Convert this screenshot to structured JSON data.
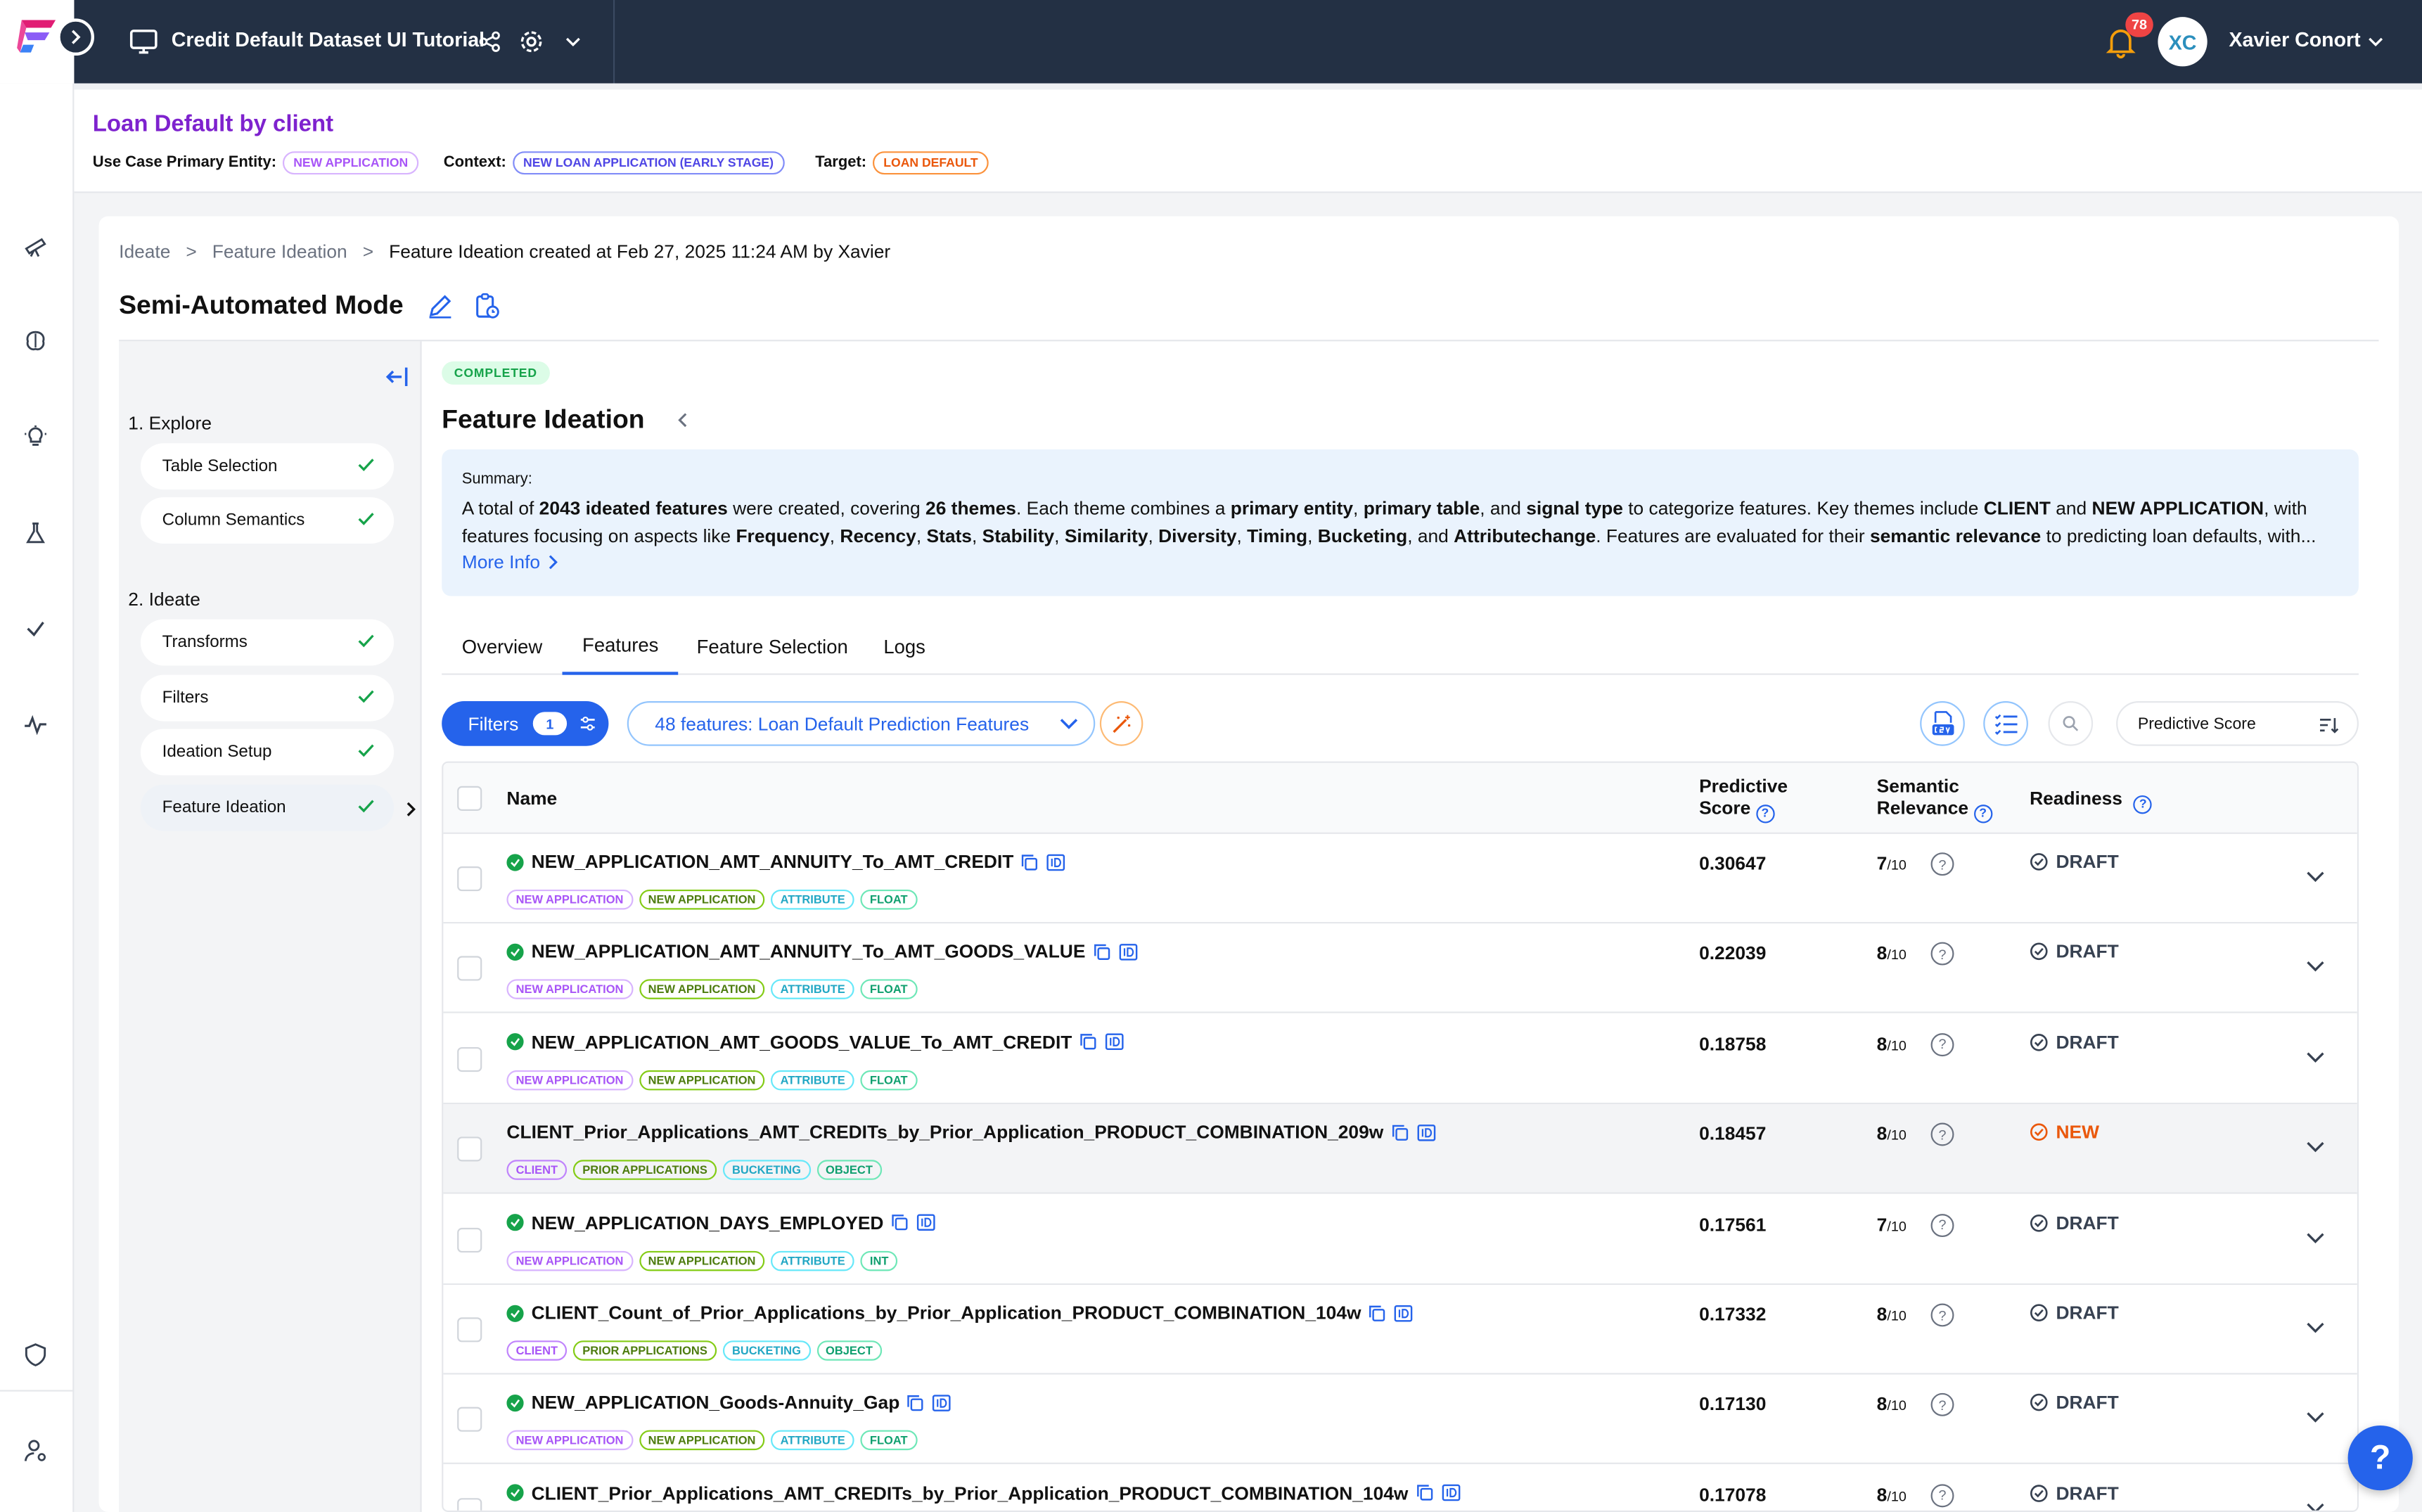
{
  "topbar": {
    "title": "Credit Default Dataset UI Tutorial",
    "notifications": "78",
    "avatar_initials": "XC",
    "user_name": "Xavier Conort"
  },
  "use_case": {
    "title": "Loan Default by client",
    "primary_entity_label": "Use Case Primary Entity:",
    "primary_entity": "NEW APPLICATION",
    "context_label": "Context:",
    "context": "NEW LOAN APPLICATION (EARLY STAGE)",
    "target_label": "Target:",
    "target": "LOAN DEFAULT"
  },
  "breadcrumb": [
    "Ideate",
    "Feature Ideation",
    "Feature Ideation created at Feb 27, 2025 11:24 AM by Xavier"
  ],
  "mode_title": "Semi-Automated Mode",
  "steps": {
    "explore_label": "1. Explore",
    "explore": [
      "Table Selection",
      "Column Semantics"
    ],
    "ideate_label": "2. Ideate",
    "ideate": [
      "Transforms",
      "Filters",
      "Ideation Setup",
      "Feature Ideation"
    ]
  },
  "status": "COMPLETED",
  "section_title": "Feature Ideation",
  "summary": {
    "heading": "Summary:",
    "line1": [
      {
        "t": "A total of "
      },
      {
        "b": "2043 ideated features"
      },
      {
        "t": " were created, covering "
      },
      {
        "b": "26 themes"
      },
      {
        "t": ". Each theme combines a "
      },
      {
        "b": "primary entity"
      },
      {
        "t": ", "
      },
      {
        "b": "primary table"
      },
      {
        "t": ", and "
      },
      {
        "b": "signal type"
      },
      {
        "t": " to categorize features. Key themes include "
      },
      {
        "b": "CLIENT"
      },
      {
        "t": " and "
      },
      {
        "b": "NEW APPLICATION"
      },
      {
        "t": ", with"
      }
    ],
    "line2": [
      {
        "t": "features focusing on aspects like "
      },
      {
        "b": "Frequency"
      },
      {
        "t": ", "
      },
      {
        "b": "Recency"
      },
      {
        "t": ", "
      },
      {
        "b": "Stats"
      },
      {
        "t": ", "
      },
      {
        "b": "Stability"
      },
      {
        "t": ", "
      },
      {
        "b": "Similarity"
      },
      {
        "t": ", "
      },
      {
        "b": "Diversity"
      },
      {
        "t": ", "
      },
      {
        "b": "Timing"
      },
      {
        "t": ", "
      },
      {
        "b": "Bucketing"
      },
      {
        "t": ", and "
      },
      {
        "b": "Attributechange"
      },
      {
        "t": ". Features are evaluated for their "
      },
      {
        "b": "semantic relevance"
      },
      {
        "t": " to predicting loan defaults, with..."
      }
    ],
    "more": "More Info"
  },
  "tabs": [
    "Overview",
    "Features",
    "Feature Selection",
    "Logs"
  ],
  "toolbar": {
    "filters_label": "Filters",
    "filters_count": "1",
    "feature_list": "48 features: Loan Default Prediction Features",
    "sort_label": "Predictive Score"
  },
  "table": {
    "col_name": "Name",
    "col_score_1": "Predictive",
    "col_score_2": "Score",
    "col_rel_1": "Semantic",
    "col_rel_2": "Relevance",
    "col_ready": "Readiness",
    "rel_suffix": "/10",
    "rows": [
      {
        "name": "NEW_APPLICATION_AMT_ANNUITY_To_AMT_CREDIT",
        "ok": true,
        "tags": [
          "NEW APPLICATION",
          "NEW APPLICATION",
          "ATTRIBUTE",
          "FLOAT"
        ],
        "score": "0.30647",
        "rel": "7",
        "ready": "DRAFT"
      },
      {
        "name": "NEW_APPLICATION_AMT_ANNUITY_To_AMT_GOODS_VALUE",
        "ok": true,
        "tags": [
          "NEW APPLICATION",
          "NEW APPLICATION",
          "ATTRIBUTE",
          "FLOAT"
        ],
        "score": "0.22039",
        "rel": "8",
        "ready": "DRAFT"
      },
      {
        "name": "NEW_APPLICATION_AMT_GOODS_VALUE_To_AMT_CREDIT",
        "ok": true,
        "tags": [
          "NEW APPLICATION",
          "NEW APPLICATION",
          "ATTRIBUTE",
          "FLOAT"
        ],
        "score": "0.18758",
        "rel": "8",
        "ready": "DRAFT"
      },
      {
        "name": "CLIENT_Prior_Applications_AMT_CREDITs_by_Prior_Application_PRODUCT_COMBINATION_209w",
        "ok": false,
        "tags": [
          "CLIENT",
          "PRIOR APPLICATIONS",
          "BUCKETING",
          "OBJECT"
        ],
        "score": "0.18457",
        "rel": "8",
        "ready": "NEW"
      },
      {
        "name": "NEW_APPLICATION_DAYS_EMPLOYED",
        "ok": true,
        "tags": [
          "NEW APPLICATION",
          "NEW APPLICATION",
          "ATTRIBUTE",
          "INT"
        ],
        "score": "0.17561",
        "rel": "7",
        "ready": "DRAFT"
      },
      {
        "name": "CLIENT_Count_of_Prior_Applications_by_Prior_Application_PRODUCT_COMBINATION_104w",
        "ok": true,
        "tags": [
          "CLIENT",
          "PRIOR APPLICATIONS",
          "BUCKETING",
          "OBJECT"
        ],
        "score": "0.17332",
        "rel": "8",
        "ready": "DRAFT"
      },
      {
        "name": "NEW_APPLICATION_Goods-Annuity_Gap",
        "ok": true,
        "tags": [
          "NEW APPLICATION",
          "NEW APPLICATION",
          "ATTRIBUTE",
          "FLOAT"
        ],
        "score": "0.17130",
        "rel": "8",
        "ready": "DRAFT"
      },
      {
        "name": "CLIENT_Prior_Applications_AMT_CREDITs_by_Prior_Application_PRODUCT_COMBINATION_104w",
        "ok": true,
        "tags": [],
        "score": "0.17078",
        "rel": "8",
        "ready": "DRAFT"
      }
    ]
  },
  "help_label": "?",
  "colors": {
    "topbar": "#233044",
    "accent": "#2563eb",
    "title_purple": "#7e22ce",
    "success": "#16a34a",
    "new_orange": "#ea580c"
  }
}
